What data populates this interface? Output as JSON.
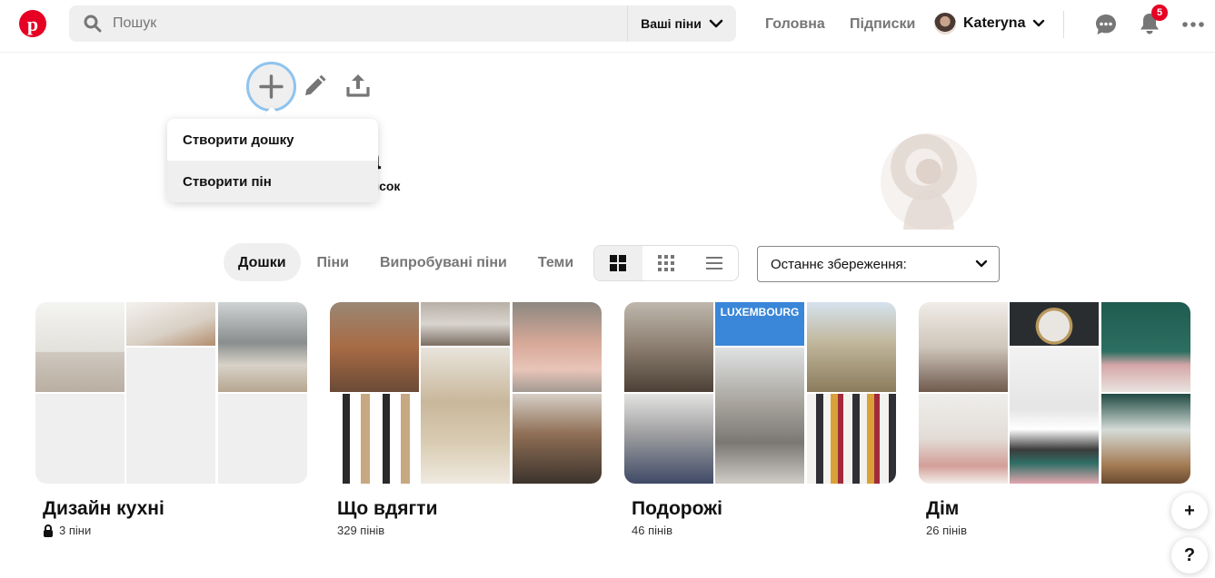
{
  "header": {
    "search_placeholder": "Пошук",
    "search_scope": "Ваші піни",
    "nav_home": "Головна",
    "nav_following": "Підписки",
    "user_name": "Kateryna",
    "notification_count": "5",
    "brand_color": "#e60023"
  },
  "create_menu": {
    "items": [
      "Створити дошку",
      "Створити пін"
    ]
  },
  "profile": {
    "name_partial": "a",
    "follow_partial": "писок"
  },
  "tabs": [
    "Дошки",
    "Піни",
    "Випробувані піни",
    "Теми"
  ],
  "sort": {
    "selected": "Останнє збереження:"
  },
  "boards": [
    {
      "title": "Дизайн кухні",
      "meta": "3 піни",
      "private": true
    },
    {
      "title": "Що вдягти",
      "meta": "329 пінів",
      "private": false
    },
    {
      "title": "Подорожі",
      "meta": "46 пінів",
      "private": false
    },
    {
      "title": "Дім",
      "meta": "26 пінів",
      "private": false
    }
  ],
  "photo_labels": {
    "luxembourg": "LUXEMBOURG"
  },
  "fab": {
    "add": "+",
    "help": "?"
  }
}
